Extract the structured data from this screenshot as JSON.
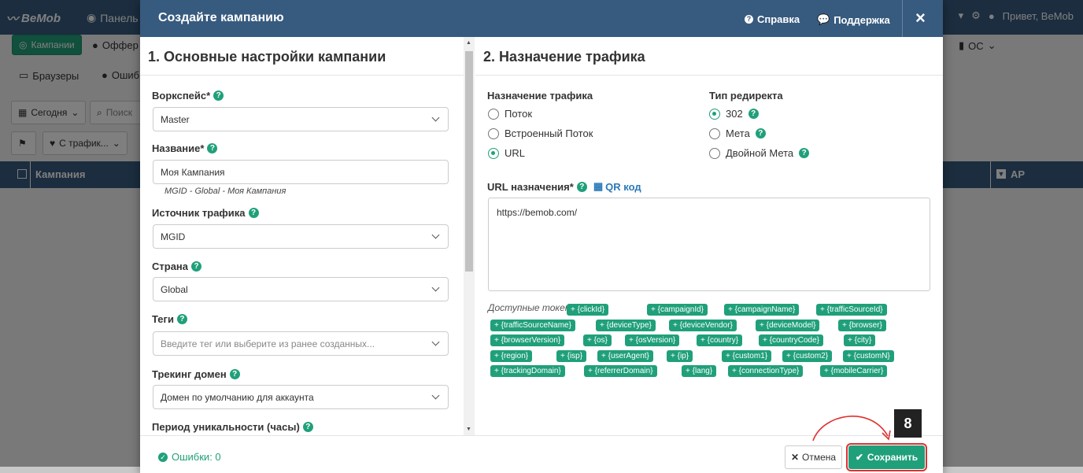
{
  "app": {
    "logo": "BeMob",
    "panel_tab": "Панель",
    "greeting": "Привет, BeMob",
    "nav_campaigns": "Кампании",
    "nav_offers": "Оффер",
    "nav_os": "ОС",
    "nav_browsers": "Браузеры",
    "nav_errors": "Ошиб",
    "filter_today": "Сегодня",
    "filter_search": "Поиск",
    "filter_traffic": "С трафик...",
    "table_col_campaign": "Кампания",
    "table_col_ap": "AP"
  },
  "modal": {
    "title": "Создайте кампанию",
    "help": "Справка",
    "support": "Поддержка",
    "close_icon": "×",
    "left": {
      "section_title": "1. Основные настройки кампании",
      "workspace_label": "Воркспейс*",
      "workspace_value": "Master",
      "name_label": "Название*",
      "name_value": "Моя Кампания",
      "name_hint": "MGID - Global - Моя Кампания",
      "source_label": "Источник трафика",
      "source_value": "MGID",
      "country_label": "Страна",
      "country_value": "Global",
      "tags_label": "Теги",
      "tags_placeholder": "Введите тег или выберите из ранее созданных...",
      "domain_label": "Трекинг домен",
      "domain_value": "Домен по умолчанию для аккаунта",
      "uniq_label": "Период уникальности (часы)"
    },
    "right": {
      "section_title": "2. Назначение трафика",
      "dest_label": "Назначение трафика",
      "dest_options": [
        "Поток",
        "Встроенный Поток",
        "URL"
      ],
      "dest_selected": "URL",
      "redirect_label": "Тип редиректа",
      "redirect_options": [
        "302",
        "Мета",
        "Двойной Мета"
      ],
      "redirect_selected": "302",
      "url_label": "URL назначения*",
      "qr_label": "QR код",
      "url_value": "https://bemob.com/",
      "tokens_label": "Доступные токены:",
      "tokens": [
        "+ {clickId}",
        "+ {campaignId}",
        "+ {campaignName}",
        "+ {trafficSourceId}",
        "+ {trafficSourceName}",
        "+ {deviceType}",
        "+ {deviceVendor}",
        "+ {deviceModel}",
        "+ {browser}",
        "+ {browserVersion}",
        "+ {os}",
        "+ {osVersion}",
        "+ {country}",
        "+ {countryCode}",
        "+ {city}",
        "+ {region}",
        "+ {isp}",
        "+ {userAgent}",
        "+ {ip}",
        "+ {custom1}",
        "+ {custom2}",
        "+ {customN}",
        "+ {trackingDomain}",
        "+ {referrerDomain}",
        "+ {lang}",
        "+ {connectionType}",
        "+ {mobileCarrier}"
      ]
    },
    "footer": {
      "errors": "Ошибки: 0",
      "cancel": "Отмена",
      "save": "Сохранить"
    }
  },
  "annotation": {
    "step_number": "8",
    "arrow_color": "#e03030"
  },
  "colors": {
    "brand": "#375a7f",
    "accent": "#20a07a"
  }
}
